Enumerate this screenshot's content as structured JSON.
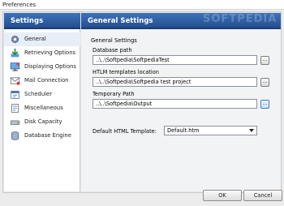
{
  "window": {
    "title": "Preferences"
  },
  "sidebar": {
    "header": "Settings",
    "items": [
      {
        "label": "General",
        "icon": "gear-icon",
        "active": true
      },
      {
        "label": "Retrieving Options",
        "icon": "download-icon"
      },
      {
        "label": "Displaying Options",
        "icon": "display-icon"
      },
      {
        "label": "Mail Connection",
        "icon": "mail-icon"
      },
      {
        "label": "Scheduler",
        "icon": "scheduler-icon"
      },
      {
        "label": "Miscellaneous",
        "icon": "misc-icon"
      },
      {
        "label": "Disk Capacity",
        "icon": "disk-icon"
      },
      {
        "label": "Database Engine",
        "icon": "database-icon"
      }
    ]
  },
  "main": {
    "header": "General Settings",
    "watermark": "SOFTPEDIA",
    "section_title": "General Settings",
    "database_path": {
      "label": "Database path",
      "value": "..\\..\\Softpedia\\SoftpediaTest"
    },
    "templates_location": {
      "label": "HTLM templates location",
      "value": "..\\..\\Softpedia\\Softpedia test project"
    },
    "temporary_path": {
      "label": "Temporary Path",
      "value": "..\\..\\Softpedia\\Output"
    },
    "browse_label": "...",
    "default_template": {
      "label": "Default HTML Template:",
      "value": "Default.htm"
    }
  },
  "footer": {
    "ok": "OK",
    "cancel": "Cancel"
  },
  "colors": {
    "header_blue": "#2f5fa5",
    "accent": "#3a7bd5"
  }
}
